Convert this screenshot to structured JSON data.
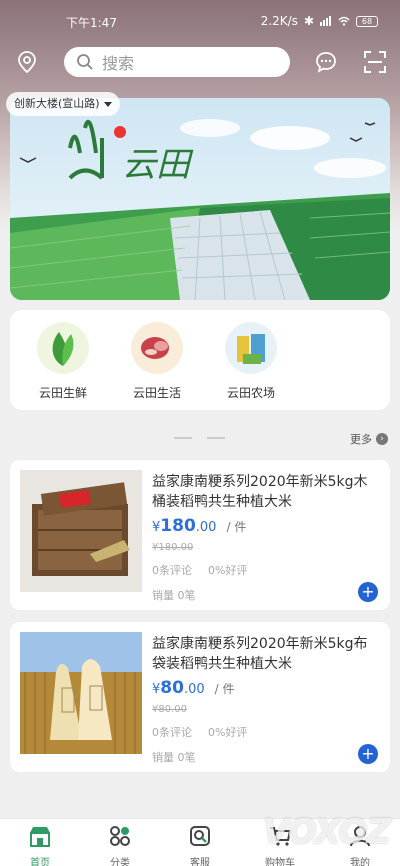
{
  "status_bar": {
    "time": "下午1:47",
    "network_speed": "2.2K/s",
    "battery": "68"
  },
  "header": {
    "search_placeholder": "搜索",
    "location_label": "创新大楼(宣山路)"
  },
  "banner": {
    "logo_text": "云田"
  },
  "categories": [
    {
      "label": "云田生鲜"
    },
    {
      "label": "云田生活"
    },
    {
      "label": "云田农场"
    }
  ],
  "section": {
    "more_label": "更多"
  },
  "products": [
    {
      "title": "益家康南粳系列2020年新米5kg木桶装稻鸭共生种植大米",
      "currency": "¥",
      "price_int": "180",
      "price_dec": ".00",
      "unit": "/ 件",
      "old_price": "¥180.00",
      "reviews": "0条评论",
      "good_rate": "0%好评",
      "sales": "销量 0笔"
    },
    {
      "title": "益家康南粳系列2020年新米5kg布袋装稻鸭共生种植大米",
      "currency": "¥",
      "price_int": "80",
      "price_dec": ".00",
      "unit": "/ 件",
      "old_price": "¥80.00",
      "reviews": "0条评论",
      "good_rate": "0%好评",
      "sales": "销量 0笔"
    }
  ],
  "tabbar": [
    {
      "label": "首页"
    },
    {
      "label": "分类"
    },
    {
      "label": "客服"
    },
    {
      "label": "购物车"
    },
    {
      "label": "我的"
    }
  ],
  "watermark": "VOXOZ",
  "colors": {
    "accent_blue": "#2d6fd6",
    "active_green": "#2f9a63"
  }
}
